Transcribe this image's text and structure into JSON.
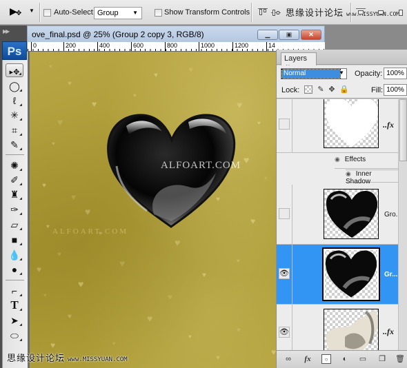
{
  "options_bar": {
    "auto_select_label": "Auto-Select:",
    "auto_select_checked": false,
    "auto_select_value": "Group",
    "show_transform_label": "Show Transform Controls",
    "show_transform_checked": false,
    "watermark_cn": "思缘设计论坛",
    "watermark_url": "www.MISSYUAN.COM"
  },
  "toolbox": {
    "logo": "Ps",
    "tools": [
      {
        "name": "move-tool",
        "glyph": "▸✥",
        "active": true
      },
      {
        "name": "marquee-tool",
        "glyph": "◯"
      },
      {
        "name": "lasso-tool",
        "glyph": "ℓ"
      },
      {
        "name": "magic-wand-tool",
        "glyph": "✳"
      },
      {
        "name": "crop-tool",
        "glyph": "⌗"
      },
      {
        "name": "eyedropper-tool",
        "glyph": "✎"
      },
      {
        "name": "spot-healing-tool",
        "glyph": "✺"
      },
      {
        "name": "brush-tool",
        "glyph": "✐"
      },
      {
        "name": "clone-stamp-tool",
        "glyph": "♜"
      },
      {
        "name": "history-brush-tool",
        "glyph": "✑"
      },
      {
        "name": "eraser-tool",
        "glyph": "▱"
      },
      {
        "name": "gradient-tool",
        "glyph": "■"
      },
      {
        "name": "blur-tool",
        "glyph": "💧"
      },
      {
        "name": "dodge-tool",
        "glyph": "●"
      },
      {
        "name": "pen-tool",
        "glyph": "⌐"
      },
      {
        "name": "type-tool",
        "glyph": "T"
      },
      {
        "name": "path-selection-tool",
        "glyph": "➤"
      },
      {
        "name": "ellipse-tool",
        "glyph": "⬭"
      }
    ]
  },
  "document": {
    "title": "ove_final.psd @ 25% (Group 2 copy 3, RGB/8)",
    "ruler_labels": [
      "0",
      "200",
      "400",
      "600",
      "800",
      "1000",
      "1200",
      "14"
    ],
    "canvas_watermark_main": "ALFOART.COM",
    "canvas_watermark_small": "ALFOART.COM"
  },
  "layers_panel": {
    "tab_label": "Layers",
    "tab_close": "×",
    "blend_mode": "Normal",
    "opacity_label": "Opacity:",
    "opacity_value": "100%",
    "lock_label": "Lock:",
    "fill_label": "Fill:",
    "fill_value": "100%",
    "layers": [
      {
        "name": "",
        "visible": false,
        "has_fx": true,
        "fx_label": "..fx",
        "thumb": "white-heart-mask",
        "selected": false
      },
      {
        "name": "Gro...",
        "visible": false,
        "has_fx": false,
        "thumb": "black-heart",
        "selected": false
      },
      {
        "name": "Gr...",
        "visible": true,
        "has_fx": false,
        "thumb": "black-heart",
        "selected": true
      },
      {
        "name": "",
        "visible": true,
        "has_fx": true,
        "fx_label": "..fx",
        "thumb": "silver-smoke",
        "selected": false
      }
    ],
    "effects_label": "Effects",
    "effect_items": [
      "Inner Shadow"
    ],
    "colors": {
      "selection": "#3295f4"
    }
  },
  "bottom_watermark": {
    "cn": "思缘设计论坛",
    "url": "www.MISSYUAN.COM"
  }
}
